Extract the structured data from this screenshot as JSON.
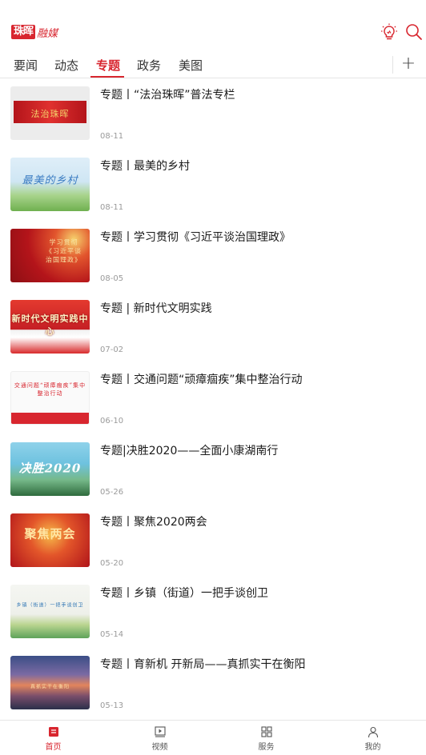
{
  "header": {
    "logo_mark": "珠晖",
    "logo_text": "融媒",
    "bulb_icon": "lightbulb-icon",
    "search_icon": "search-icon"
  },
  "tabs": [
    {
      "label": "要闻"
    },
    {
      "label": "动态"
    },
    {
      "label": "专题",
      "active": true
    },
    {
      "label": "政务"
    },
    {
      "label": "美图"
    }
  ],
  "tab_add": "+",
  "articles": [
    {
      "title": "专题丨“法治珠晖”普法专栏",
      "date": "08-11",
      "thumb_text": "法治珠晖"
    },
    {
      "title": "专题丨最美的乡村",
      "date": "08-11",
      "thumb_text": "最美的乡村"
    },
    {
      "title": "专题丨学习贯彻《习近平谈治国理政》",
      "date": "08-05",
      "thumb_text": "学习贯彻《习近平谈治国理政》"
    },
    {
      "title": "专题 | 新时代文明实践",
      "date": "07-02",
      "thumb_text": "新时代文明实践中心"
    },
    {
      "title": "专题丨交通问题“顽瘴痼疾”集中整治行动",
      "date": "06-10",
      "thumb_text": "交通问题“顽瘴痼疾”集中整治行动"
    },
    {
      "title": "专题|决胜2020——全面小康湖南行",
      "date": "05-26",
      "thumb_text": "决胜2020"
    },
    {
      "title": "专题丨聚焦2020两会",
      "date": "05-20",
      "thumb_text": "聚焦两会"
    },
    {
      "title": "专题丨乡镇（街道）一把手谈创卫",
      "date": "05-14",
      "thumb_text": "乡镇（街道）一把手谈创卫"
    },
    {
      "title": "专题丨育新机  开新局——真抓实干在衡阳",
      "date": "05-13",
      "thumb_text": "真抓实干在衡阳"
    }
  ],
  "bottom_nav": [
    {
      "label": "首页",
      "icon": "home-icon",
      "active": true
    },
    {
      "label": "视频",
      "icon": "video-icon"
    },
    {
      "label": "服务",
      "icon": "grid-icon"
    },
    {
      "label": "我的",
      "icon": "user-icon"
    }
  ],
  "colors": {
    "accent": "#d8262f",
    "text": "#1a1a1a",
    "muted": "#9a9a9a"
  }
}
